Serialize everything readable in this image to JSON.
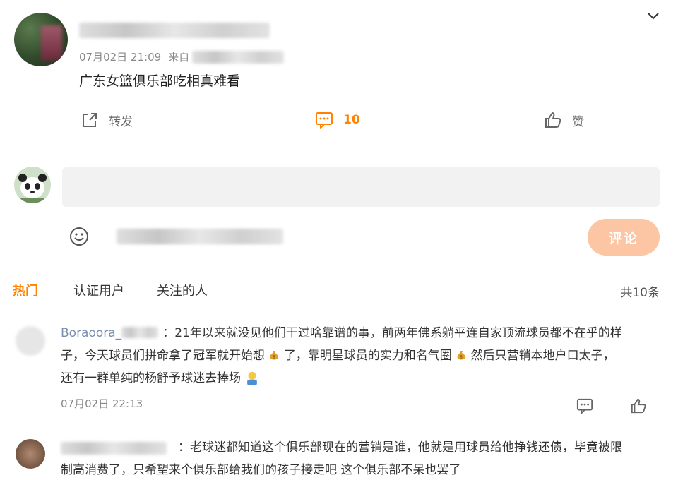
{
  "post": {
    "timestamp": "07月02日 21:09",
    "source_prefix": "来自",
    "text": "广东女篮俱乐部吃相真难看",
    "actions": {
      "repost_label": "转发",
      "comment_count": "10",
      "like_label": "赞"
    }
  },
  "composer": {
    "placeholder": "",
    "submit_label": "评论"
  },
  "tabs": {
    "items": [
      "热门",
      "认证用户",
      "关注的人"
    ],
    "active": "热门",
    "total": "共10条"
  },
  "comments": [
    {
      "name": "Boraoora_",
      "separator": "：",
      "text_line1": "21年以来就没见他们干过啥靠谱的事，前两年佛系躺平连自家顶流球员都不在乎的样",
      "text_line2a": "子，今天球员们拼命拿了冠军就开始想",
      "text_line2b": "了，靠明星球员的实力和名气圈",
      "text_line2c": "然后只营销本地户口太子，",
      "text_line3": "还有一群单纯的杨舒予球迷去捧场",
      "timestamp": "07月02日 22:13"
    },
    {
      "separator": "：",
      "text_line1": "老球迷都知道这个俱乐部现在的营销是谁，他就是用球员给他挣钱还债，毕竟被限",
      "text_line2": "制高消费了，只希望来个俱乐部给我们的孩子接走吧 这个俱乐部不呆也罢了"
    }
  ],
  "icons": {
    "menu": "chevron-down-icon",
    "repost": "share-icon",
    "comment": "comment-icon",
    "like": "thumbs-up-icon",
    "emoji": "smiley-icon"
  },
  "colors": {
    "accent": "#ff8200",
    "submit_bg": "#fcc6a4",
    "username": "#7a8eb0"
  }
}
